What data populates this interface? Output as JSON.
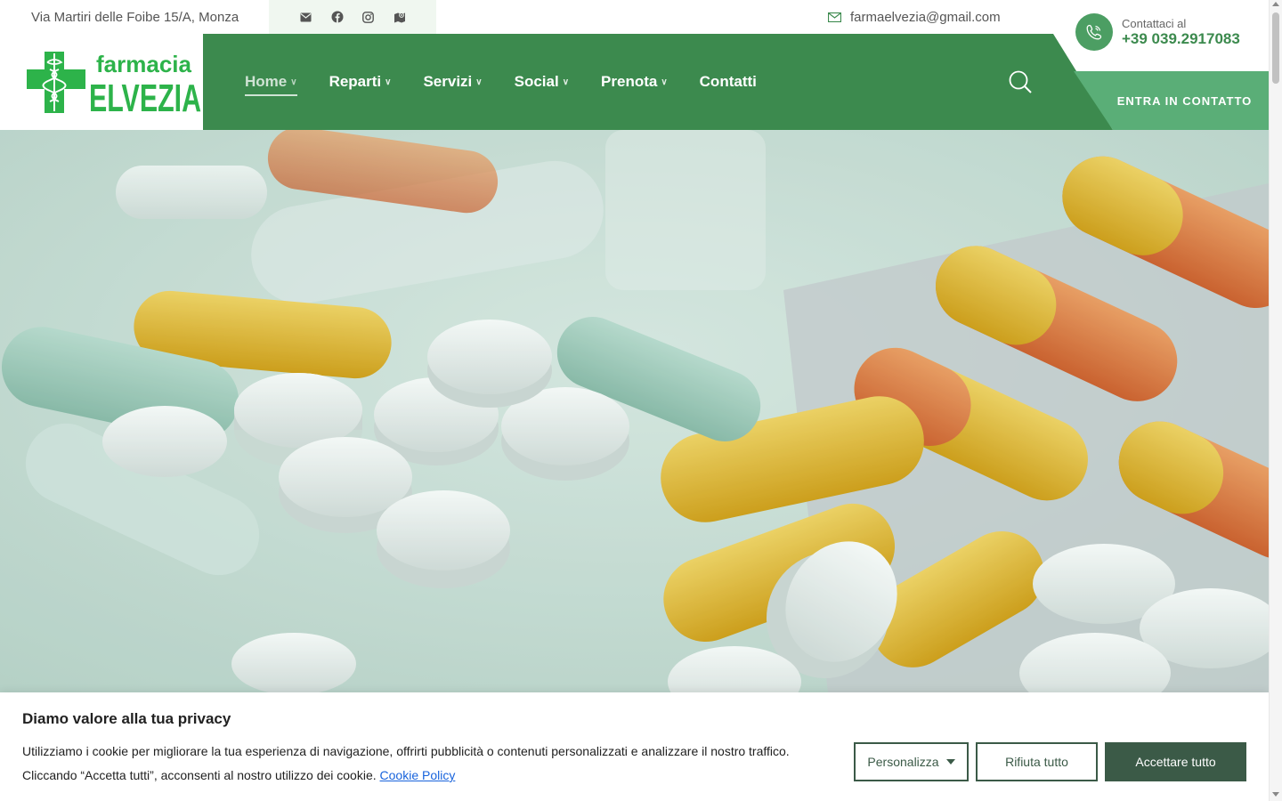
{
  "topbar": {
    "address": "Via Martiri delle Foibe 15/A, Monza",
    "email": "farmaelvezia@gmail.com",
    "social_icons": [
      "envelope-icon",
      "facebook-icon",
      "instagram-icon",
      "map-icon"
    ]
  },
  "contact": {
    "label": "Contattaci al",
    "phone": "+39 039.2917083",
    "cta": "ENTRA IN CONTATTO"
  },
  "logo": {
    "line1": "farmacia",
    "line2": "ELVEZIA"
  },
  "nav": {
    "items": [
      {
        "label": "Home",
        "dropdown": true,
        "active": true
      },
      {
        "label": "Reparti",
        "dropdown": true
      },
      {
        "label": "Servizi",
        "dropdown": true
      },
      {
        "label": "Social",
        "dropdown": true
      },
      {
        "label": "Prenota",
        "dropdown": true
      },
      {
        "label": "Contatti",
        "dropdown": false
      }
    ]
  },
  "cookie": {
    "title": "Diamo valore alla tua privacy",
    "text_line1": "Utilizziamo i cookie per migliorare la tua esperienza di navigazione, offrirti pubblicità o contenuti personalizzati e analizzare il nostro traffico.",
    "text_line2": "Cliccando “Accetta tutti”, acconsenti al nostro utilizzo dei cookie.",
    "policy_link": "Cookie Policy",
    "customize": "Personalizza",
    "reject": "Rifiuta tutto",
    "accept": "Accettare tutto"
  },
  "colors": {
    "brand_green": "#3c8a4e",
    "light_green": "#5aae77",
    "button_dark": "#3b5a47",
    "logo_green": "#2db34a"
  }
}
